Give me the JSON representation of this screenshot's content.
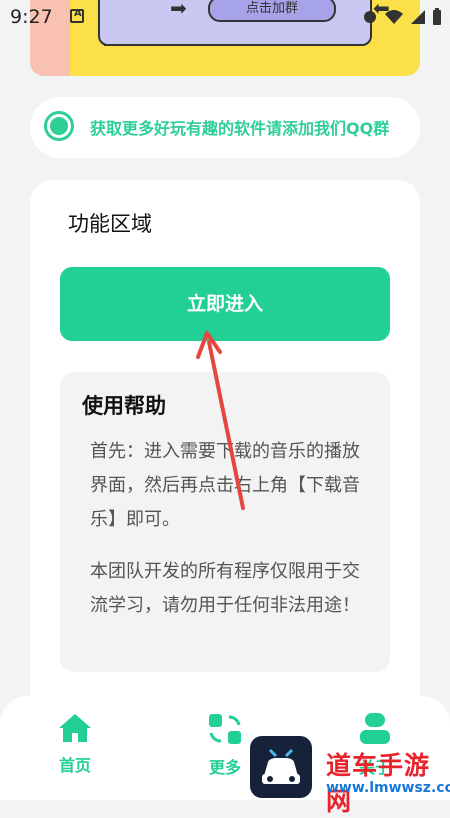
{
  "status_bar": {
    "time": "9:27"
  },
  "banner": {
    "button_label": "点击加群"
  },
  "notice": {
    "text": "获取更多好玩有趣的软件请添加我们QQ群"
  },
  "card": {
    "title": "功能区域",
    "enter_button": "立即进入",
    "help": {
      "title": "使用帮助",
      "paragraph1": "首先：进入需要下载的音乐的播放界面，然后再点击右上角【下载音乐】即可。",
      "paragraph2": "本团队开发的所有程序仅限用于交流学习，请勿用于任何非法用途！"
    }
  },
  "bottom_nav": [
    {
      "label": "首页",
      "icon": "home-icon"
    },
    {
      "label": "更多",
      "icon": "refresh-grid-icon"
    },
    {
      "label": "关于",
      "icon": "user-icon"
    }
  ],
  "watermark": {
    "brand": "道车手游网",
    "url": "www.lmwwsz.com"
  },
  "colors": {
    "accent": "#22cf95",
    "background": "#f2f3f5",
    "banner": "#fbe04a",
    "annotation": "#e4473f"
  }
}
